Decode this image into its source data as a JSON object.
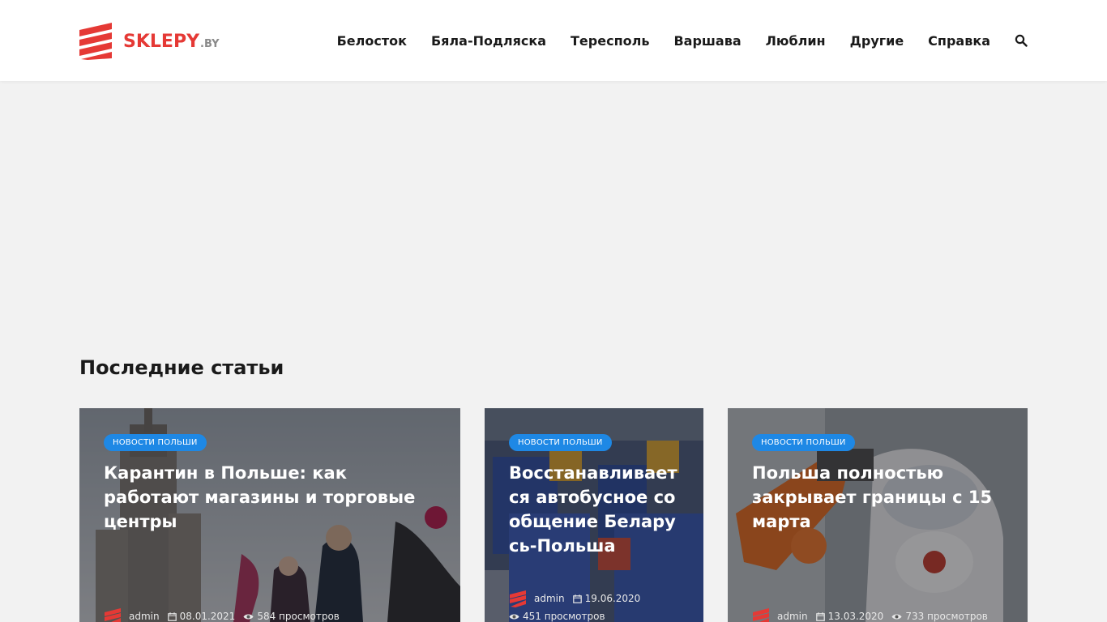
{
  "brand": {
    "name": "SKLEPY",
    "tld": ".BY",
    "logo_color": "#e53935"
  },
  "nav": {
    "items": [
      {
        "label": "Белосток"
      },
      {
        "label": "Бяла-Подляска"
      },
      {
        "label": "Тересполь"
      },
      {
        "label": "Варшава"
      },
      {
        "label": "Люблин"
      },
      {
        "label": "Другие"
      },
      {
        "label": "Справка"
      }
    ],
    "search_icon": "search-icon"
  },
  "section": {
    "title": "Последние статьи"
  },
  "colors": {
    "badge": "#1e88e5",
    "background": "#f2f2f2",
    "header": "#ffffff"
  },
  "articles": [
    {
      "category": "Новости Польши",
      "title": "Карантин в Польше: как работают магазины и торговые центры",
      "author": "admin",
      "date": "08.01.2021",
      "views": "584 просмотров"
    },
    {
      "category": "Новости Польши",
      "title": "Восстанавливается автобусное сообщение Беларусь-Польша",
      "author": "admin",
      "date": "19.06.2020",
      "views": "451 просмотров"
    },
    {
      "category": "Новости Польши",
      "title": "Польша полностью закрывает границы с 15 марта",
      "author": "admin",
      "date": "13.03.2020",
      "views": "733 просмотров"
    }
  ]
}
